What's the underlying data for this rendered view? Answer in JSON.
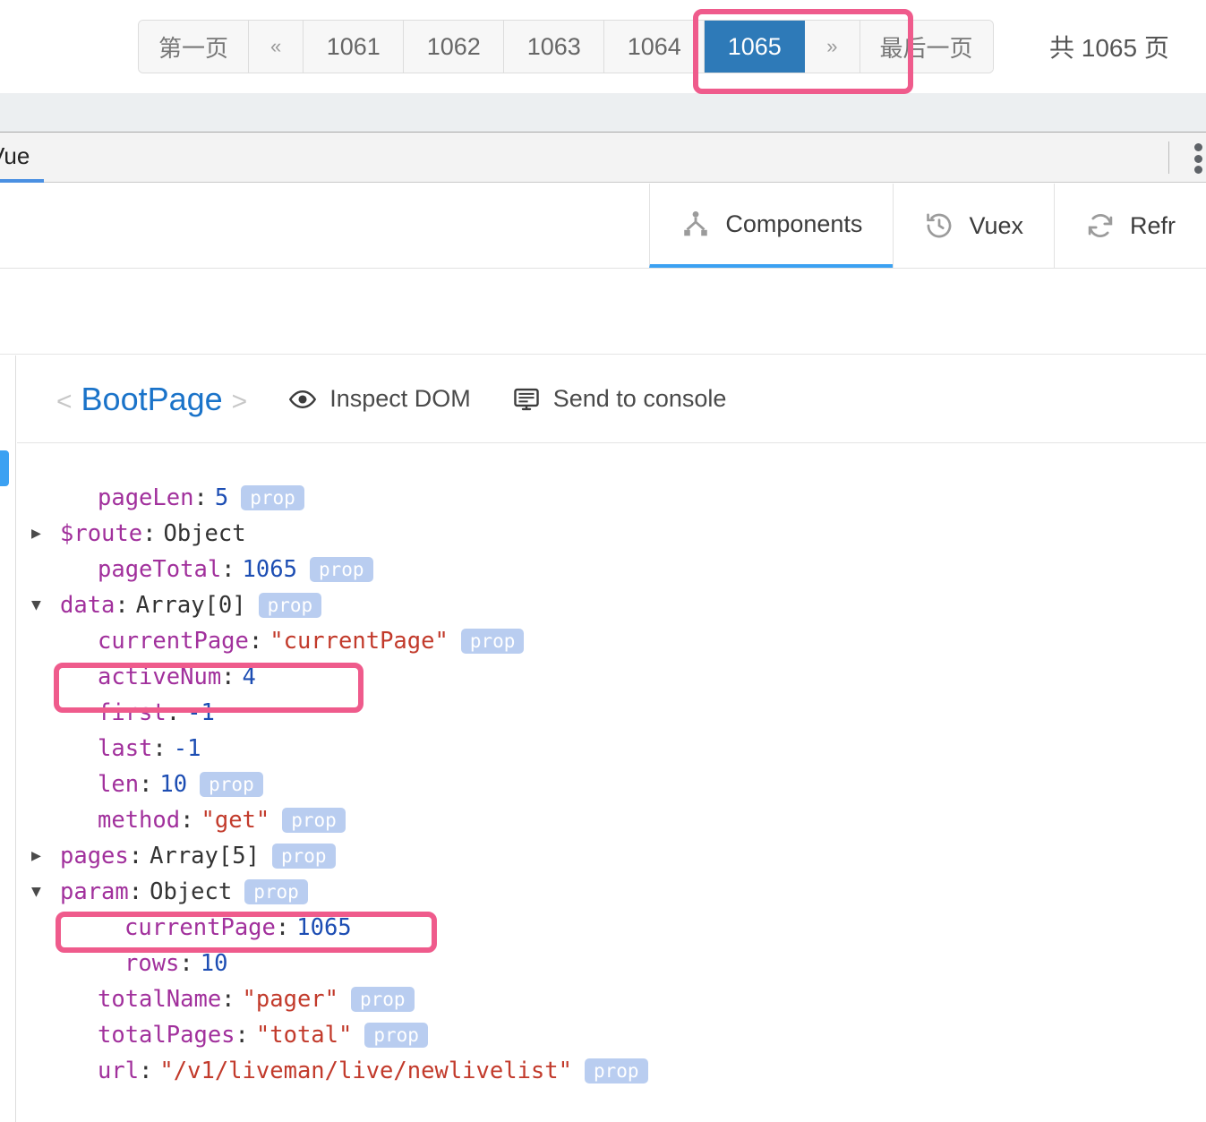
{
  "pagination": {
    "first_label": "第一页",
    "prev_label": "«",
    "next_label": "»",
    "last_label": "最后一页",
    "pages": [
      "1061",
      "1062",
      "1063",
      "1064",
      "1065"
    ],
    "active_page": "1065",
    "total_text": "共 1065 页",
    "active_color": "#2e7ab8"
  },
  "devtools": {
    "tab_label": "Vue",
    "kebab_name": "more-options",
    "toolbar": [
      {
        "label": "Components",
        "icon": "components-icon",
        "active": true
      },
      {
        "label": "Vuex",
        "icon": "history-clock-icon",
        "active": false
      },
      {
        "label": "Refr",
        "icon": "refresh-icon",
        "active": false
      }
    ]
  },
  "inspector": {
    "open_angle": "<",
    "component_name": "BootPage",
    "close_angle": ">",
    "actions": [
      {
        "label": "Inspect DOM",
        "icon": "eye-icon"
      },
      {
        "label": "Send to console",
        "icon": "console-icon"
      }
    ],
    "badge_label": "prop",
    "properties": [
      {
        "arrow": "",
        "indent": "noarrow",
        "key": "pageLen",
        "value": "5",
        "vtype": "num",
        "badge": true
      },
      {
        "arrow": "▶",
        "indent": "",
        "key": "$route",
        "value": "Object",
        "vtype": "obj",
        "badge": false
      },
      {
        "arrow": "",
        "indent": "noarrow",
        "key": "pageTotal",
        "value": "1065",
        "vtype": "num",
        "badge": true
      },
      {
        "arrow": "▼",
        "indent": "",
        "key": "data",
        "value": "Array[0]",
        "vtype": "obj",
        "badge": true
      },
      {
        "arrow": "",
        "indent": "noarrow",
        "key": "currentPage",
        "value": "\"currentPage\"",
        "vtype": "str",
        "badge": true
      },
      {
        "arrow": "",
        "indent": "noarrow",
        "key": "activeNum",
        "value": "4",
        "vtype": "num",
        "badge": false
      },
      {
        "arrow": "",
        "indent": "noarrow",
        "key": "first",
        "value": "-1",
        "vtype": "num",
        "badge": false
      },
      {
        "arrow": "",
        "indent": "noarrow",
        "key": "last",
        "value": "-1",
        "vtype": "num",
        "badge": false
      },
      {
        "arrow": "",
        "indent": "noarrow",
        "key": "len",
        "value": "10",
        "vtype": "num",
        "badge": true
      },
      {
        "arrow": "",
        "indent": "noarrow",
        "key": "method",
        "value": "\"get\"",
        "vtype": "str",
        "badge": true
      },
      {
        "arrow": "▶",
        "indent": "",
        "key": "pages",
        "value": "Array[5]",
        "vtype": "obj",
        "badge": true
      },
      {
        "arrow": "▼",
        "indent": "",
        "key": "param",
        "value": "Object",
        "vtype": "obj",
        "badge": true
      },
      {
        "arrow": "",
        "indent": "nested",
        "key": "currentPage",
        "value": "1065",
        "vtype": "num",
        "badge": false
      },
      {
        "arrow": "",
        "indent": "nested",
        "key": "rows",
        "value": "10",
        "vtype": "num",
        "badge": false
      },
      {
        "arrow": "",
        "indent": "noarrow",
        "key": "totalName",
        "value": "\"pager\"",
        "vtype": "str",
        "badge": true
      },
      {
        "arrow": "",
        "indent": "noarrow",
        "key": "totalPages",
        "value": "\"total\"",
        "vtype": "str",
        "badge": true
      },
      {
        "arrow": "",
        "indent": "noarrow",
        "key": "url",
        "value": "\"/v1/liveman/live/newlivelist\"",
        "vtype": "str",
        "badge": true
      }
    ]
  },
  "annotations": {
    "color": "#ef5b8c",
    "boxes": [
      "active-page-button",
      "activeNum-row",
      "param-currentPage-row"
    ]
  }
}
